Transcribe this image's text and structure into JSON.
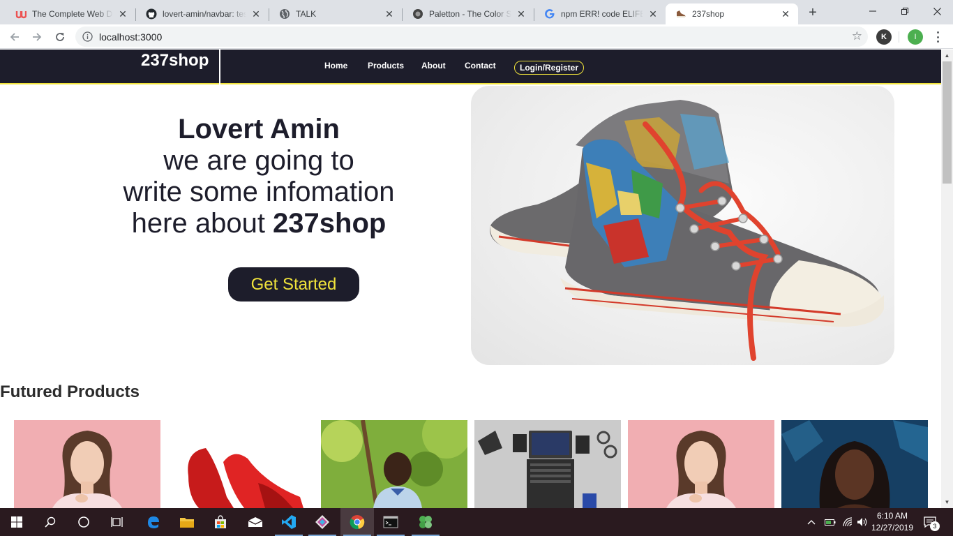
{
  "browser": {
    "tabs": [
      {
        "title": "The Complete Web Dev",
        "icon": "udemy-icon"
      },
      {
        "title": "lovert-amin/navbar: tes",
        "icon": "github-icon"
      },
      {
        "title": "TALK",
        "icon": "globe-icon"
      },
      {
        "title": "Paletton - The Color Sch",
        "icon": "paletton-icon"
      },
      {
        "title": "npm ERR! code ELIFECY",
        "icon": "google-icon"
      },
      {
        "title": "237shop",
        "icon": "shoe-icon",
        "active": true
      }
    ],
    "url": "localhost:3000",
    "profile_k": "K",
    "profile_i": "I"
  },
  "site": {
    "brand": "237shop",
    "nav": [
      "Home",
      "Products",
      "About",
      "Contact"
    ],
    "login_label": "Login/Register",
    "colors": {
      "dark": "#1d1d2b",
      "accent": "#f0e33b"
    }
  },
  "hero": {
    "name": "Lovert Amin",
    "line1": "we are going to",
    "line2": "write some infomation",
    "line3_prefix": "here about ",
    "line3_bold": "237shop",
    "cta_label": "Get Started"
  },
  "featured": {
    "title": "Futured Products",
    "products": [
      {
        "subject": "woman-pink-background"
      },
      {
        "subject": "red-high-heels"
      },
      {
        "subject": "child-outdoors"
      },
      {
        "subject": "laptop-desk"
      },
      {
        "subject": "woman-pink-background"
      },
      {
        "subject": "woman-blue-background"
      }
    ]
  },
  "taskbar": {
    "time": "6:10 AM",
    "date": "12/27/2019",
    "notifications": "3"
  }
}
